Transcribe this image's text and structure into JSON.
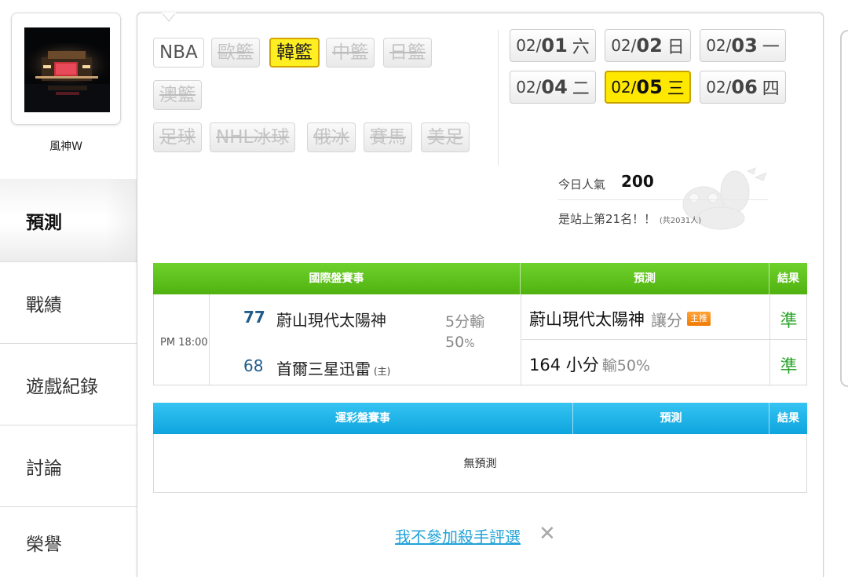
{
  "profile": {
    "username": "風神W"
  },
  "nav": [
    {
      "label": "預測",
      "active": true
    },
    {
      "label": "戰績",
      "active": false
    },
    {
      "label": "遊戲紀錄",
      "active": false
    },
    {
      "label": "討論",
      "active": false
    },
    {
      "label": "榮譽",
      "active": false
    }
  ],
  "leagues": [
    {
      "label": "NBA",
      "state": "available"
    },
    {
      "label": "歐籃",
      "state": "disabled"
    },
    {
      "label": "韓籃",
      "state": "active"
    },
    {
      "label": "中籃",
      "state": "disabled"
    },
    {
      "label": "日籃",
      "state": "disabled"
    },
    {
      "label": "澳籃",
      "state": "disabled"
    },
    {
      "label": "足球",
      "state": "disabled"
    },
    {
      "label": "NHL冰球",
      "state": "disabled"
    },
    {
      "label": "俄冰",
      "state": "disabled"
    },
    {
      "label": "賽馬",
      "state": "disabled"
    },
    {
      "label": "美足",
      "state": "disabled"
    }
  ],
  "dates": [
    {
      "month": "02/",
      "day": "01",
      "weekday": "六",
      "active": false
    },
    {
      "month": "02/",
      "day": "02",
      "weekday": "日",
      "active": false
    },
    {
      "month": "02/",
      "day": "03",
      "weekday": "一",
      "active": false
    },
    {
      "month": "02/",
      "day": "04",
      "weekday": "二",
      "active": false
    },
    {
      "month": "02/",
      "day": "05",
      "weekday": "三",
      "active": true
    },
    {
      "month": "02/",
      "day": "06",
      "weekday": "四",
      "active": false
    }
  ],
  "popularity": {
    "label": "今日人氣",
    "count": "200",
    "rank_text": "是站上第21名！！",
    "rank_total": "(共2031人)"
  },
  "intl_table": {
    "headers": [
      "國際盤賽事",
      "預測",
      "結果"
    ],
    "game": {
      "time": "PM 18:00",
      "away_code": "77",
      "away_name": "蔚山現代太陽神",
      "home_code": "68",
      "home_name": "首爾三星迅雷",
      "home_tag": "(主)",
      "line": "5分輸",
      "line_pct_num": "50",
      "line_pct_unit": "%",
      "pred1_team": "蔚山現代太陽神",
      "pred1_type": "讓分",
      "pred1_badge": "主推",
      "pred2_value": "164 小分",
      "pred2_odds": "輸50%",
      "result1": "準",
      "result2": "準"
    }
  },
  "lottery_table": {
    "headers": [
      "運彩盤賽事",
      "預測",
      "結果"
    ],
    "empty_text": "無預測"
  },
  "optout": {
    "label": "我不參加殺手評選",
    "close": "✕"
  },
  "colors": {
    "accent_yellow": "#ffe800",
    "green_header": "#4fb20f",
    "blue_header": "#0ea4de",
    "result_green": "#2aa42a",
    "link_blue": "#23a3d8",
    "badge_orange": "#f07a00"
  }
}
